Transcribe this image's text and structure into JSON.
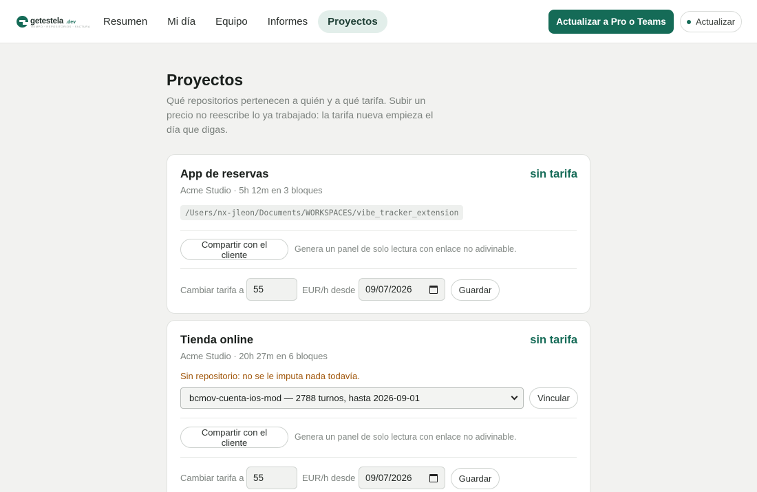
{
  "brand": {
    "name": "getestela",
    "tld": ".dev",
    "tagline": "TIEMPO · REPOSITORIOS · FACTURA"
  },
  "nav": {
    "items": [
      {
        "label": "Resumen"
      },
      {
        "label": "Mi día"
      },
      {
        "label": "Equipo"
      },
      {
        "label": "Informes"
      },
      {
        "label": "Proyectos",
        "active": true
      }
    ]
  },
  "header": {
    "upgrade_label": "Actualizar a Pro o Teams",
    "update_label": "Actualizar"
  },
  "main": {
    "title": "Proyectos",
    "description": "Qué repositorios pertenecen a quién y a qué tarifa. Subir un precio no reescribe lo ya trabajado: la tarifa nueva empieza el día que digas."
  },
  "projects": [
    {
      "name": "App de reservas",
      "badge": "sin tarifa",
      "meta": "Acme Studio · 5h 12m en 3 bloques",
      "path": "/Users/nx-jleon/Documents/WORKSPACES/vibe_tracker_extension",
      "share_label": "Compartir con el cliente",
      "share_hint": "Genera un panel de solo lectura con enlace no adivinable.",
      "rate_label": "Cambiar tarifa a",
      "rate_value": "55",
      "rate_unit": "EUR/h desde",
      "date_value": "09/07/2026",
      "save_label": "Guardar"
    },
    {
      "name": "Tienda online",
      "badge": "sin tarifa",
      "meta": "Acme Studio · 20h 27m en 6 bloques",
      "warning": "Sin repositorio: no se le imputa nada todavía.",
      "repo_option": "bcmov-cuenta-ios-mod — 2788 turnos, hasta 2026-09-01",
      "link_label": "Vincular",
      "share_label": "Compartir con el cliente",
      "share_hint": "Genera un panel de solo lectura con enlace no adivinable.",
      "rate_label": "Cambiar tarifa a",
      "rate_value": "55",
      "rate_unit": "EUR/h desde",
      "date_value": "09/07/2026",
      "save_label": "Guardar"
    }
  ]
}
